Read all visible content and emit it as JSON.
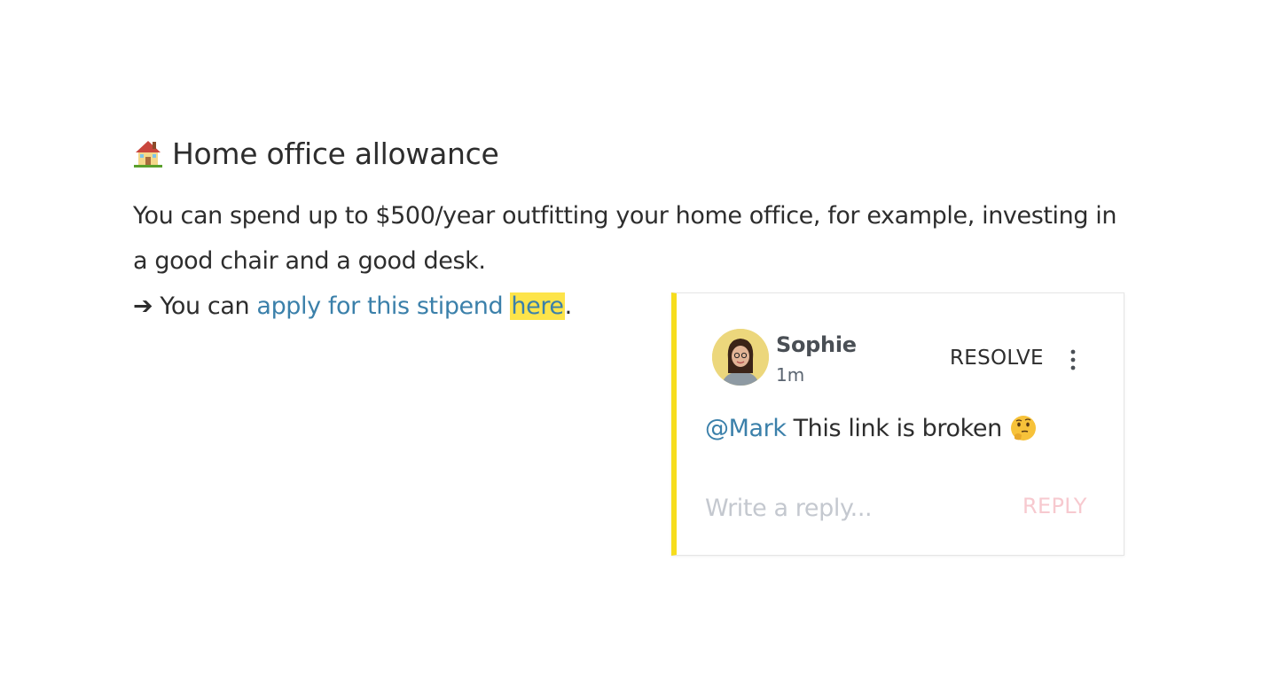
{
  "document": {
    "heading_icon": "house-icon",
    "heading": "Home office allowance",
    "paragraph": "You can spend up to $500/year outfitting your home office, for example, investing in a good chair and a good desk.",
    "line3_prefix": "➔ You can ",
    "link_text": "apply for this stipend ",
    "highlighted_link_text": "here",
    "line3_suffix": "."
  },
  "comment": {
    "author": "Sophie",
    "time": "1m",
    "resolve_label": "RESOLVE",
    "more_icon": "more-vertical-icon",
    "mention": "@Mark",
    "text": "This link is broken",
    "text_icon": "thinking-face-icon",
    "reply_placeholder": "Write a reply...",
    "reply_label": "REPLY",
    "accent_color": "#f6dd1d",
    "highlight_color": "#fde44a",
    "link_color": "#3b80aa"
  }
}
